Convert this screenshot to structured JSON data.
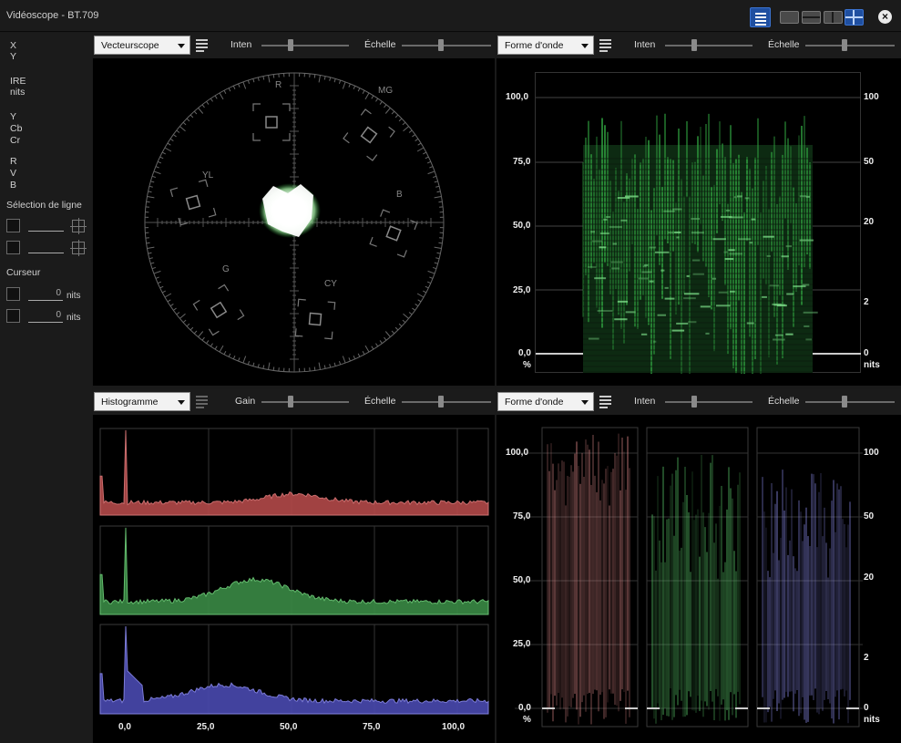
{
  "window": {
    "title": "Vidéoscope - BT.709"
  },
  "sidebar": {
    "xy_labels": [
      "X",
      "Y"
    ],
    "ire_labels": [
      "IRE",
      "nits"
    ],
    "ycbcr_labels": [
      "Y",
      "Cb",
      "Cr"
    ],
    "rvb_labels": [
      "R",
      "V",
      "B"
    ],
    "line_selection_title": "Sélection de ligne",
    "cursor_title": "Curseur",
    "cursor_rows": [
      {
        "value": "0",
        "unit": "nits"
      },
      {
        "value": "0",
        "unit": "nits"
      }
    ]
  },
  "panels": {
    "top_left": {
      "scope": "Vecteurscope",
      "param1": "Inten",
      "param1_level": 0.3,
      "param2": "Échelle",
      "param2_level": 0.4,
      "targets": [
        "R",
        "MG",
        "YL",
        "B",
        "G",
        "CY"
      ]
    },
    "top_right": {
      "scope": "Forme d'onde",
      "param1": "Inten",
      "param1_level": 0.3,
      "param2": "Échelle",
      "param2_level": 0.4,
      "left_ticks": [
        "100,0",
        "75,0",
        "50,0",
        "25,0",
        "0,0"
      ],
      "left_unit": "%",
      "right_ticks": [
        "100",
        "50",
        "20",
        "2",
        "0"
      ],
      "right_unit": "nits"
    },
    "bottom_left": {
      "scope": "Histogramme",
      "param1": "Gain",
      "param1_level": 0.3,
      "param2": "Échelle",
      "param2_level": 0.4,
      "x_ticks": [
        "0,0",
        "25,0",
        "50,0",
        "75,0",
        "100,0"
      ]
    },
    "bottom_right": {
      "scope": "Forme d'onde",
      "param1": "Inten",
      "param1_level": 0.3,
      "param2": "Échelle",
      "param2_level": 0.4,
      "left_ticks": [
        "100,0",
        "75,0",
        "50,0",
        "25,0",
        "0,0"
      ],
      "left_unit": "%",
      "right_ticks": [
        "100",
        "50",
        "20",
        "2",
        "0"
      ],
      "right_unit": "nits"
    }
  },
  "colors": {
    "red": "#d06060",
    "green": "#3aa04a",
    "blue": "#6060d0",
    "accent": "#1f4fa0"
  }
}
